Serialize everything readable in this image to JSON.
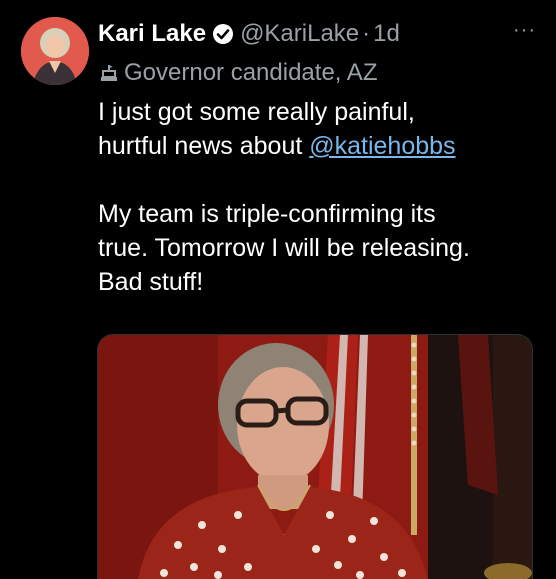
{
  "tweet": {
    "author": {
      "name": "Kari Lake",
      "handle": "@KariLake",
      "separator": "·",
      "time": "1d",
      "label": "Governor candidate, AZ"
    },
    "text": {
      "line1": "I just got some really painful,",
      "line2_prefix": "hurtful news about ",
      "mention": "@katiehobbs",
      "para2_line1": "My team is triple-confirming its",
      "para2_line2": "true. Tomorrow I will be releasing.",
      "para2_line3": "Bad stuff!"
    },
    "more_label": "···"
  },
  "colors": {
    "background": "#000000",
    "primary_text": "#ffffff",
    "secondary_text": "#9aa1a6",
    "link": "#7ab6ea"
  },
  "icons": {
    "verified": "verified-badge-icon",
    "label": "government-building-icon",
    "more": "more-options-icon"
  }
}
